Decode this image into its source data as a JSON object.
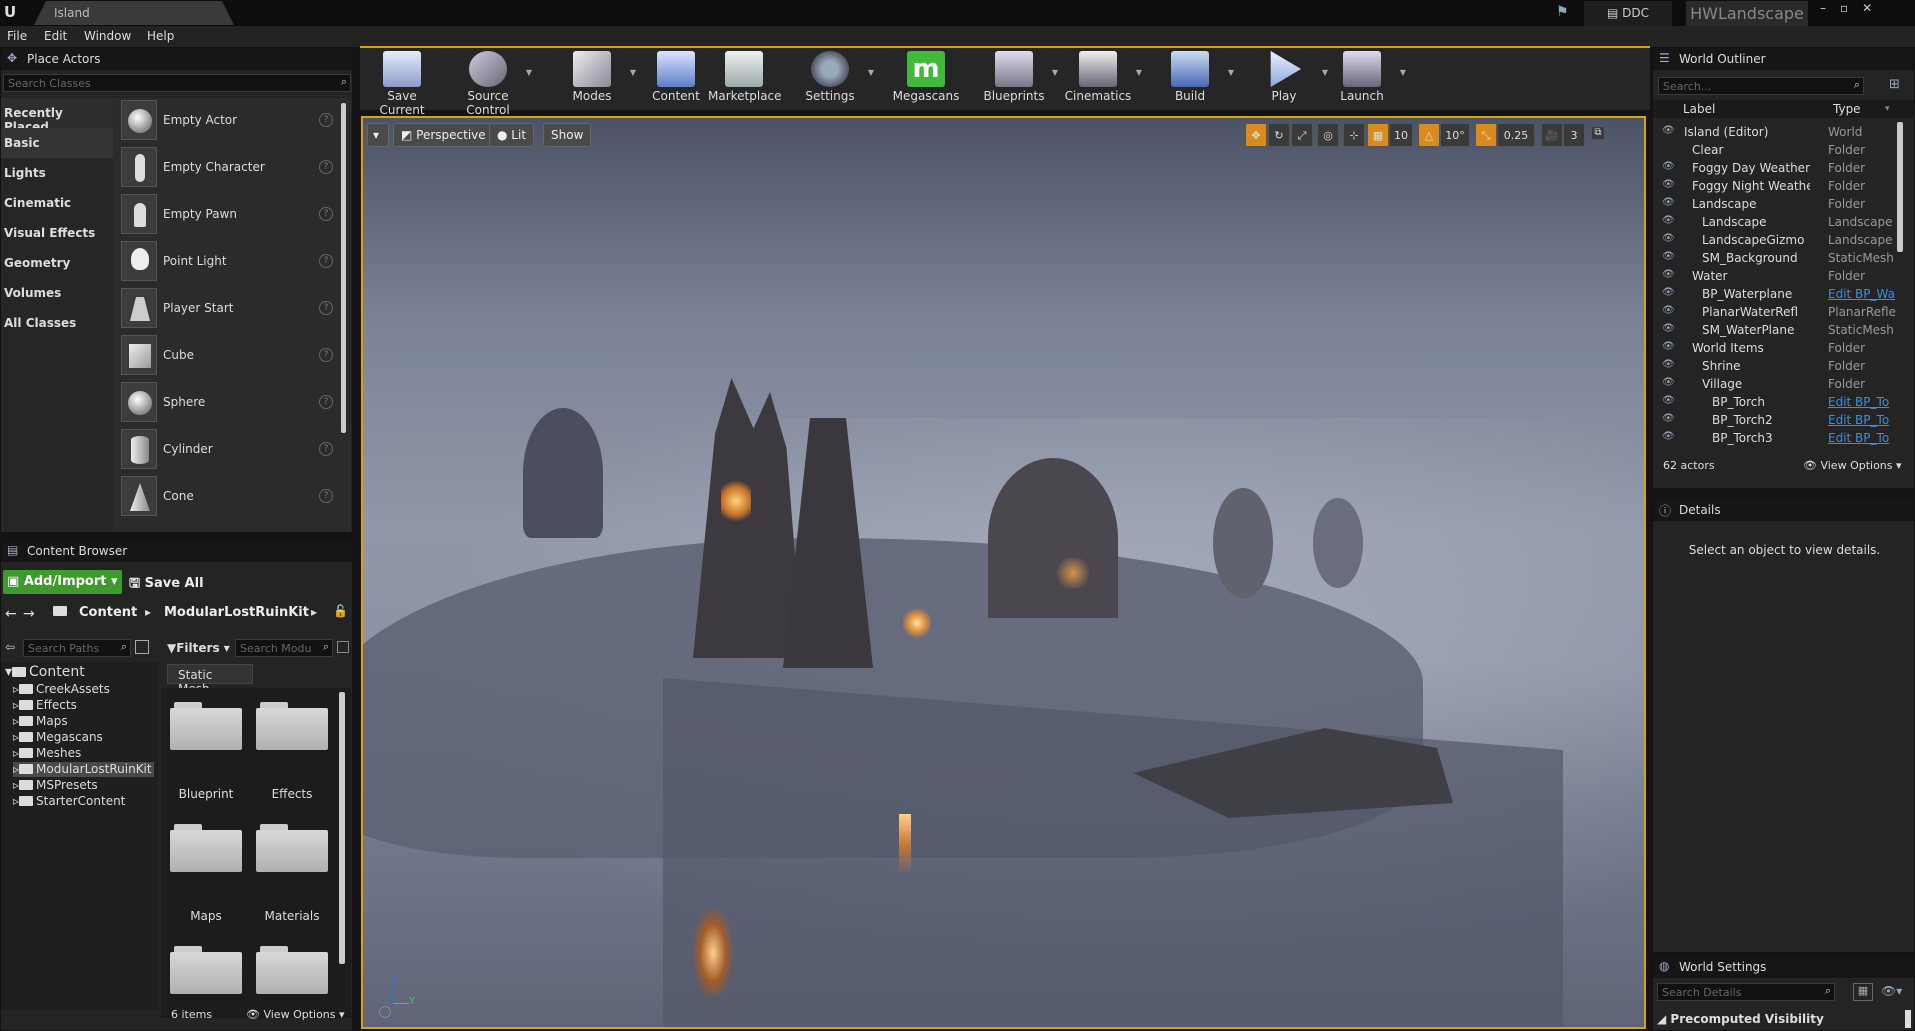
{
  "titlebar": {
    "doc_tab": "Island",
    "ddc": "DDC",
    "project": "HWLandscape"
  },
  "menu": [
    "File",
    "Edit",
    "Window",
    "Help"
  ],
  "place_actors": {
    "title": "Place Actors",
    "search_placeholder": "Search Classes",
    "categories": [
      "Recently Placed",
      "Basic",
      "Lights",
      "Cinematic",
      "Visual Effects",
      "Geometry",
      "Volumes",
      "All Classes"
    ],
    "items": [
      "Empty Actor",
      "Empty Character",
      "Empty Pawn",
      "Point Light",
      "Player Start",
      "Cube",
      "Sphere",
      "Cylinder",
      "Cone"
    ]
  },
  "toolbar": [
    {
      "label": "Save Current",
      "icon": "save-icon"
    },
    {
      "label": "Source Control",
      "icon": "source-control-icon"
    },
    {
      "label": "Modes",
      "icon": "modes-icon"
    },
    {
      "label": "Content",
      "icon": "content-icon"
    },
    {
      "label": "Marketplace",
      "icon": "marketplace-icon"
    },
    {
      "label": "Settings",
      "icon": "settings-icon"
    },
    {
      "label": "Megascans",
      "icon": "megascans-icon"
    },
    {
      "label": "Blueprints",
      "icon": "blueprints-icon"
    },
    {
      "label": "Cinematics",
      "icon": "cinematics-icon"
    },
    {
      "label": "Build",
      "icon": "build-icon"
    },
    {
      "label": "Play",
      "icon": "play-icon"
    },
    {
      "label": "Launch",
      "icon": "launch-icon"
    }
  ],
  "viewport": {
    "perspective": "Perspective",
    "lit": "Lit",
    "show": "Show",
    "grid": "10",
    "rot": "10°",
    "scale": "0.25",
    "cam_speed": "3"
  },
  "content_browser": {
    "title": "Content Browser",
    "add_import": "Add/Import",
    "save_all": "Save All",
    "path": [
      "Content",
      "ModularLostRuinKit"
    ],
    "search_paths": "Search Paths",
    "filters": "Filters",
    "search_folder": "Search Modu",
    "filter_chip": "Static Mesh",
    "root": "Content",
    "folders": [
      "CreekAssets",
      "Effects",
      "Maps",
      "Megascans",
      "Meshes",
      "ModularLostRuinKit",
      "MSPresets",
      "StarterContent"
    ],
    "assets": [
      "Blueprint",
      "Effects",
      "Maps",
      "Materials",
      "",
      ""
    ],
    "count": "6 items",
    "view_options": "View Options"
  },
  "outliner": {
    "title": "World Outliner",
    "search": "Search...",
    "col_label": "Label",
    "col_type": "Type",
    "rows": [
      {
        "name": "Island (Editor)",
        "type": "World"
      },
      {
        "name": "Clear",
        "type": "Folder"
      },
      {
        "name": "Foggy Day Weather",
        "type": "Folder"
      },
      {
        "name": "Foggy Night Weather",
        "type": "Folder"
      },
      {
        "name": "Landscape",
        "type": "Folder"
      },
      {
        "name": "Landscape",
        "type": "Landscape"
      },
      {
        "name": "LandscapeGizmo",
        "type": "Landscape"
      },
      {
        "name": "SM_Background",
        "type": "StaticMesh"
      },
      {
        "name": "Water",
        "type": "Folder"
      },
      {
        "name": "BP_Waterplane",
        "type": "Edit BP_Wa"
      },
      {
        "name": "PlanarWaterRefl",
        "type": "PlanarRefle"
      },
      {
        "name": "SM_WaterPlane",
        "type": "StaticMesh"
      },
      {
        "name": "World Items",
        "type": "Folder"
      },
      {
        "name": "Shrine",
        "type": "Folder"
      },
      {
        "name": "Village",
        "type": "Folder"
      },
      {
        "name": "BP_Torch",
        "type": "Edit BP_To"
      },
      {
        "name": "BP_Torch2",
        "type": "Edit BP_To"
      },
      {
        "name": "BP_Torch3",
        "type": "Edit BP_To"
      }
    ],
    "count": "62 actors",
    "view_options": "View Options"
  },
  "details": {
    "title": "Details",
    "empty": "Select an object to view details."
  },
  "world_settings": {
    "title": "World Settings",
    "search": "Search Details",
    "section": "Precomputed Visibility"
  }
}
